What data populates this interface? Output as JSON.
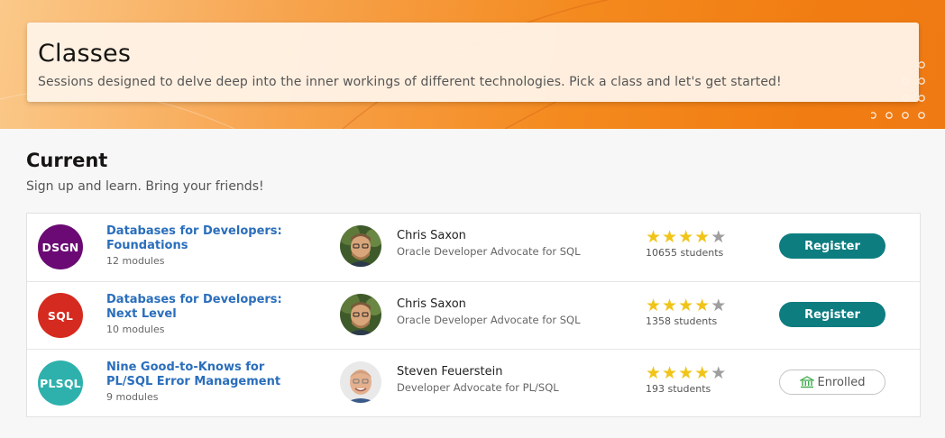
{
  "hero": {
    "title": "Classes",
    "subtitle": "Sessions designed to delve deep into the inner workings of different technologies. Pick a class and let's get started!"
  },
  "section": {
    "title": "Current",
    "subtitle": "Sign up and learn. Bring your friends!"
  },
  "classes": [
    {
      "badge": "DSGN",
      "badge_color": "#6b0a74",
      "title": "Databases for Developers: Foundations",
      "modules": "12 modules",
      "instructor_name": "Chris Saxon",
      "instructor_role": "Oracle Developer Advocate for SQL",
      "rating": 4,
      "students": "10655 students",
      "action": "Register"
    },
    {
      "badge": "SQL",
      "badge_color": "#d52a1f",
      "title": "Databases for Developers: Next Level",
      "modules": "10 modules",
      "instructor_name": "Chris Saxon",
      "instructor_role": "Oracle Developer Advocate for SQL",
      "rating": 4,
      "students": "1358 students",
      "action": "Register"
    },
    {
      "badge": "PLSQL",
      "badge_color": "#2eb1ad",
      "title": "Nine Good-to-Knows for PL/SQL Error Management",
      "modules": "9 modules",
      "instructor_name": "Steven Feuerstein",
      "instructor_role": "Developer Advocate for PL/SQL",
      "rating": 4,
      "students": "193 students",
      "action": "Enrolled"
    }
  ],
  "colors": {
    "accent": "#0d7d80",
    "link": "#2a6ebb",
    "star": "#f0c419",
    "hero": "#f48a1f"
  }
}
